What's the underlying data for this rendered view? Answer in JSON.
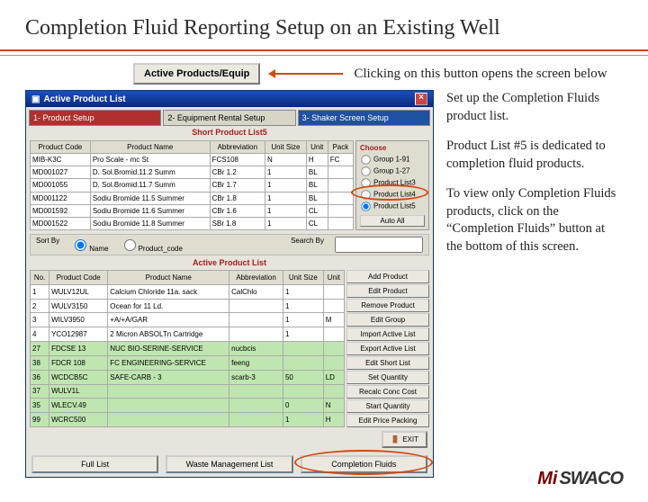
{
  "title": "Completion Fluid Reporting Setup on an Existing Well",
  "topbtn": "Active Products/Equip",
  "caption": "Clicking on this button opens the screen below",
  "win_title": "Active Product List",
  "tabs": [
    "1- Product Setup",
    "2- Equipment Rental Setup",
    "3- Shaker Screen Setup"
  ],
  "short_title": "Short Product List5",
  "short_cols": [
    "Product Code",
    "Product Name",
    "Abbreviation",
    "Unit Size",
    "Unit",
    "Pack"
  ],
  "short_rows": [
    [
      "MIB-K3C",
      "Pro Scale - mc St",
      "FCS108",
      "N",
      "H",
      "FC"
    ],
    [
      "MD001027",
      "D. Sol.Bromid.11.2 Summ",
      "CBr 1.2",
      "1",
      "BL",
      ""
    ],
    [
      "MD001055",
      "D. Sol.Bromid.11.7 Summ",
      "CBr 1.7",
      "1",
      "BL",
      ""
    ],
    [
      "MD001122",
      "Sodiu Bromide 11.5 Summer",
      "CBr 1.8",
      "1",
      "BL",
      ""
    ],
    [
      "MD001592",
      "Sodiu Bromide 11.6 Summer",
      "CBr 1.6",
      "1",
      "CL",
      ""
    ],
    [
      "MD001522",
      "Sodiu Bromide 11.8 Summer",
      "SBr 1.8",
      "1",
      "CL",
      ""
    ]
  ],
  "choose": {
    "hd": "Choose",
    "opts": [
      "Group 1-91",
      "Group 1-27",
      "Product List3",
      "Product List4",
      "Product List5"
    ],
    "sel": 4,
    "btn": "Auto All"
  },
  "sort": {
    "label": "Sort By",
    "name": "Name",
    "code": "Product_code",
    "search_label": "Search By",
    "search_val": ""
  },
  "apl_title": "Active Product List",
  "apl_cols": [
    "No.",
    "Product Code",
    "Product Name",
    "Abbreviation",
    "Unit Size",
    "Unit"
  ],
  "apl_rows": [
    [
      "1",
      "WULV12UL",
      "Calcium Chloride 11a. sack",
      "CalChlo",
      "1",
      ""
    ],
    [
      "2",
      "WULV3150",
      "Ocean for 11 Ld.",
      "",
      "1",
      ""
    ],
    [
      "3",
      "WILV3950",
      "+A/+A/GAR",
      "",
      "1",
      "M"
    ],
    [
      "4",
      "YCO12987",
      "2 Micron ABSOLTn Cartridge",
      "",
      "1",
      ""
    ],
    [
      "27",
      "FDCSE 13",
      "NUC BIO-SERINE-SERVICE",
      "nucbcis",
      "",
      ""
    ],
    [
      "38",
      "FDCR 108",
      "FC ENGINEERING-SERVICE",
      "feeng",
      "",
      ""
    ],
    [
      "36",
      "WCDCB5C",
      "SAFE-CARB - 3",
      "scarb-3",
      "50",
      "LD"
    ],
    [
      "37",
      "WULV1L",
      "",
      "",
      "",
      ""
    ],
    [
      "35",
      "WLECV.49",
      "",
      "",
      "0",
      "N"
    ],
    [
      "99",
      "WCRC500",
      "",
      "",
      "1",
      "H"
    ]
  ],
  "sidebtns": [
    "Add Product",
    "Edit Product",
    "Remove Product",
    "Edit Group",
    "Import Active List",
    "Export Active List",
    "Edit Short List",
    "Set Quantity",
    "Recalc Conc Cost",
    "Start Quantity",
    "Edit Price Packing"
  ],
  "bottom": [
    "Full List",
    "Waste Management List",
    "Completion Fluids"
  ],
  "exit": "EXIT",
  "right": [
    "Set up the Completion Fluids product list.",
    "Product List #5 is dedicated to completion fluid products.",
    "To view only Completion Fluids products, click on the “Completion Fluids” button at the bottom of this screen."
  ],
  "logo": {
    "mi": "Mi",
    "sw": "SWACO"
  }
}
